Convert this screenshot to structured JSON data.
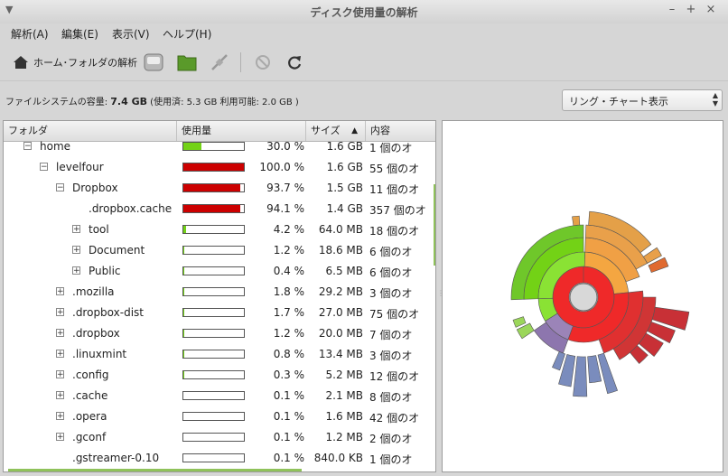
{
  "window": {
    "title": "ディスク使用量の解析"
  },
  "menu": {
    "items": [
      "解析(A)",
      "編集(E)",
      "表示(V)",
      "ヘルプ(H)"
    ]
  },
  "toolbar": {
    "home_label": "ホーム･フォルダの解析"
  },
  "status": {
    "prefix": "ファイルシステムの容量: ",
    "capacity": "7.4 GB",
    "detail": " (使用済: 5.3 GB 利用可能: 2.0 GB )"
  },
  "view_select": {
    "selected": "リング・チャート表示"
  },
  "table": {
    "headers": {
      "folder": "フォルダ",
      "usage": "使用量",
      "size": "サイズ",
      "contents": "内容"
    },
    "rows": [
      {
        "indent": 1,
        "expander": "minus",
        "name": "home",
        "usage": 0.3,
        "bar_color": "#73d216",
        "pct": "30.0 %",
        "size": "1.6 GB",
        "contents": "1 個のオ"
      },
      {
        "indent": 2,
        "expander": "minus",
        "name": "levelfour",
        "usage": 1.0,
        "bar_color": "#cc0000",
        "pct": "100.0 %",
        "size": "1.6 GB",
        "contents": "55 個のオ"
      },
      {
        "indent": 3,
        "expander": "minus",
        "name": "Dropbox",
        "usage": 0.937,
        "bar_color": "#cc0000",
        "pct": "93.7 %",
        "size": "1.5 GB",
        "contents": "11 個のオ"
      },
      {
        "indent": 4,
        "expander": "none",
        "name": ".dropbox.cache",
        "usage": 0.941,
        "bar_color": "#cc0000",
        "pct": "94.1 %",
        "size": "1.4 GB",
        "contents": "357 個のオ"
      },
      {
        "indent": 4,
        "expander": "plus",
        "name": "tool",
        "usage": 0.042,
        "bar_color": "#73d216",
        "pct": "4.2 %",
        "size": "64.0 MB",
        "contents": "18 個のオ"
      },
      {
        "indent": 4,
        "expander": "plus",
        "name": "Document",
        "usage": 0.012,
        "bar_color": "#73d216",
        "pct": "1.2 %",
        "size": "18.6 MB",
        "contents": "6 個のオ"
      },
      {
        "indent": 4,
        "expander": "plus",
        "name": "Public",
        "usage": 0.004,
        "bar_color": "#73d216",
        "pct": "0.4 %",
        "size": "6.5 MB",
        "contents": "6 個のオ"
      },
      {
        "indent": 3,
        "expander": "plus",
        "name": ".mozilla",
        "usage": 0.018,
        "bar_color": "#73d216",
        "pct": "1.8 %",
        "size": "29.2 MB",
        "contents": "3 個のオ"
      },
      {
        "indent": 3,
        "expander": "plus",
        "name": ".dropbox-dist",
        "usage": 0.017,
        "bar_color": "#73d216",
        "pct": "1.7 %",
        "size": "27.0 MB",
        "contents": "75 個のオ"
      },
      {
        "indent": 3,
        "expander": "plus",
        "name": ".dropbox",
        "usage": 0.012,
        "bar_color": "#73d216",
        "pct": "1.2 %",
        "size": "20.0 MB",
        "contents": "7 個のオ"
      },
      {
        "indent": 3,
        "expander": "plus",
        "name": ".linuxmint",
        "usage": 0.008,
        "bar_color": "#73d216",
        "pct": "0.8 %",
        "size": "13.4 MB",
        "contents": "3 個のオ"
      },
      {
        "indent": 3,
        "expander": "plus",
        "name": ".config",
        "usage": 0.003,
        "bar_color": "#73d216",
        "pct": "0.3 %",
        "size": "5.2 MB",
        "contents": "12 個のオ"
      },
      {
        "indent": 3,
        "expander": "plus",
        "name": ".cache",
        "usage": 0.001,
        "bar_color": "#73d216",
        "pct": "0.1 %",
        "size": "2.1 MB",
        "contents": "8 個のオ"
      },
      {
        "indent": 3,
        "expander": "plus",
        "name": ".opera",
        "usage": 0.001,
        "bar_color": "#73d216",
        "pct": "0.1 %",
        "size": "1.6 MB",
        "contents": "42 個のオ"
      },
      {
        "indent": 3,
        "expander": "plus",
        "name": ".gconf",
        "usage": 0.001,
        "bar_color": "#73d216",
        "pct": "0.1 %",
        "size": "1.2 MB",
        "contents": "2 個のオ"
      },
      {
        "indent": 3,
        "expander": "none",
        "name": ".gstreamer-0.10",
        "usage": 0.001,
        "bar_color": "#73d216",
        "pct": "0.1 %",
        "size": "840.0 KB",
        "contents": "1 個のオ"
      }
    ]
  },
  "ring_chart": {
    "center_color": "#d8d8d8",
    "rings": [
      {
        "level": 1,
        "segments": [
          {
            "start": 0,
            "end": 360,
            "color": "#ef2929"
          }
        ]
      },
      {
        "level": 2,
        "segments": [
          {
            "start": -90,
            "end": 0,
            "color": "#8ae234"
          },
          {
            "start": 0,
            "end": 88,
            "color": "#f4a641"
          },
          {
            "start": 88,
            "end": 210,
            "color": "#ef2929"
          },
          {
            "start": 210,
            "end": 240,
            "color": "#9b84b8"
          },
          {
            "start": 240,
            "end": 265,
            "color": "#8ae234"
          },
          {
            "start": 265,
            "end": 270,
            "color": "#729fcf"
          }
        ]
      }
    ]
  }
}
